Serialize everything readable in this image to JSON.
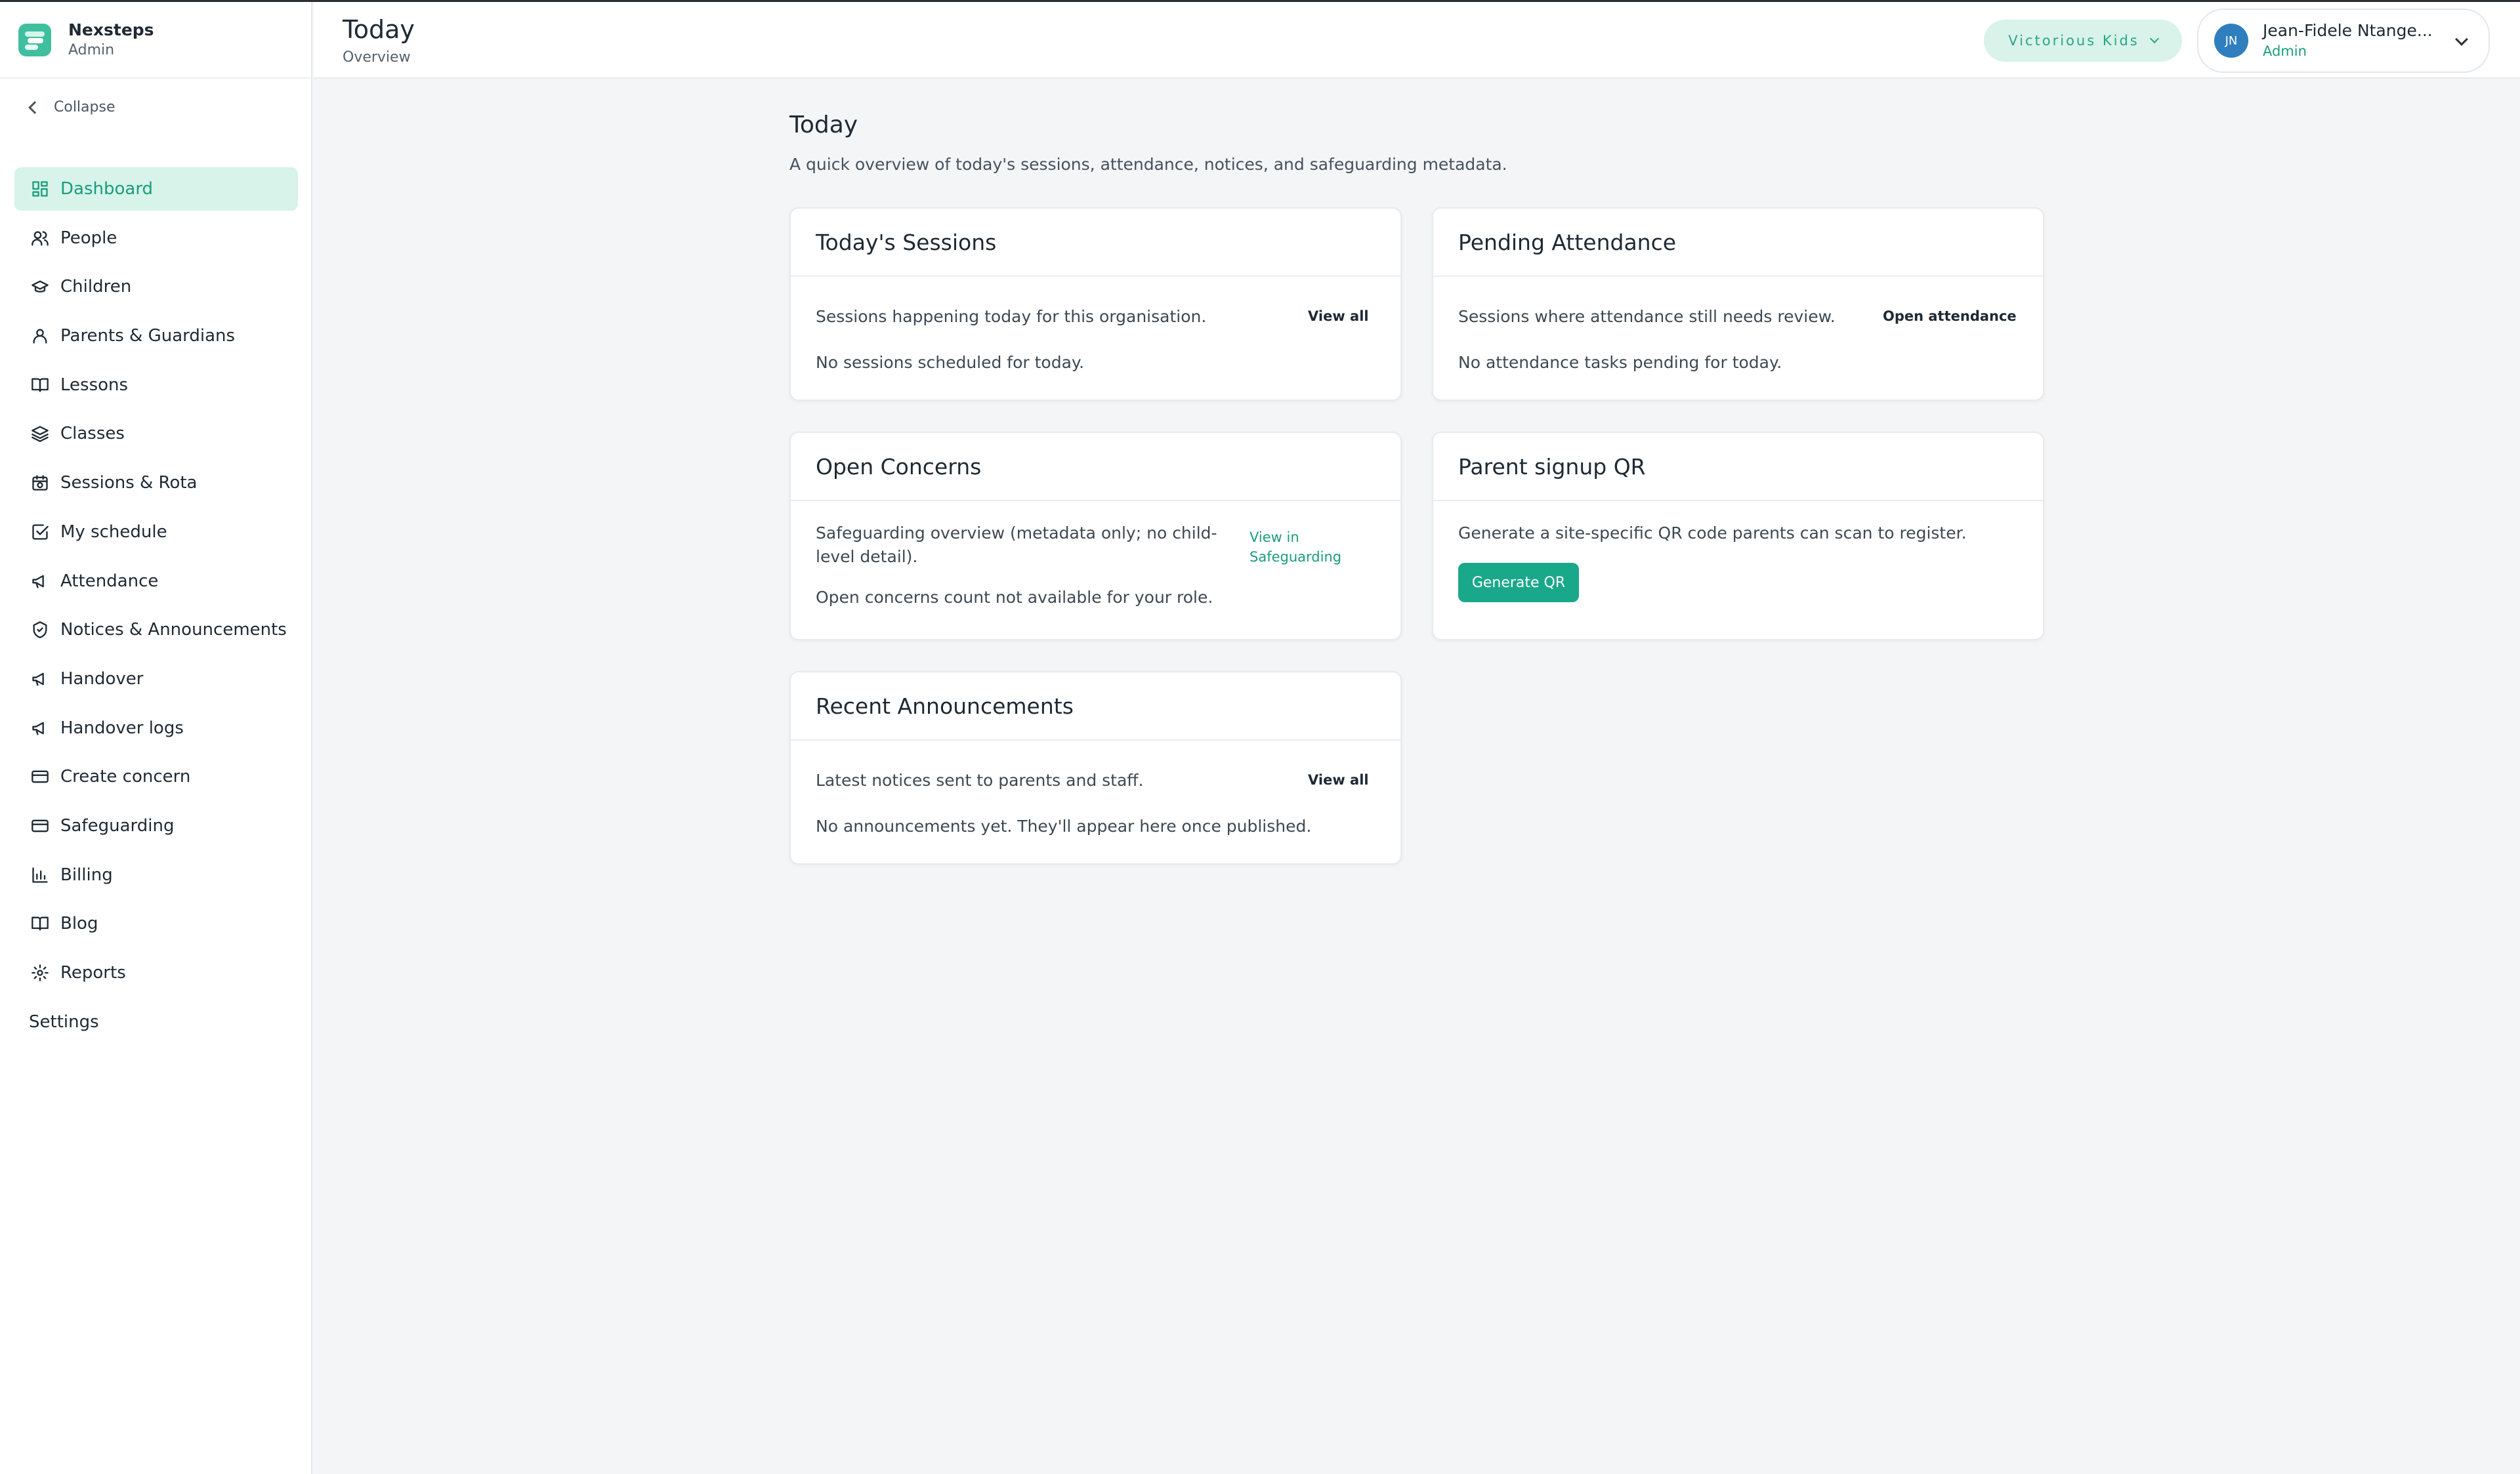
{
  "brand": {
    "name": "Nexsteps",
    "role": "Admin"
  },
  "sidebar": {
    "collapse_label": "Collapse",
    "items": [
      {
        "label": "Dashboard",
        "icon": "grid-icon"
      },
      {
        "label": "People",
        "icon": "users-icon"
      },
      {
        "label": "Children",
        "icon": "graduation-cap-icon"
      },
      {
        "label": "Parents & Guardians",
        "icon": "user-icon"
      },
      {
        "label": "Lessons",
        "icon": "book-icon"
      },
      {
        "label": "Classes",
        "icon": "layers-icon"
      },
      {
        "label": "Sessions & Rota",
        "icon": "calendar-clock-icon"
      },
      {
        "label": "My schedule",
        "icon": "check-square-icon"
      },
      {
        "label": "Attendance",
        "icon": "megaphone-icon"
      },
      {
        "label": "Notices & Announcements",
        "icon": "shield-icon"
      },
      {
        "label": "Handover",
        "icon": "megaphone-icon"
      },
      {
        "label": "Handover logs",
        "icon": "megaphone-icon"
      },
      {
        "label": "Create concern",
        "icon": "card-icon"
      },
      {
        "label": "Safeguarding",
        "icon": "card-icon"
      },
      {
        "label": "Billing",
        "icon": "bar-chart-icon"
      },
      {
        "label": "Blog",
        "icon": "book-icon"
      },
      {
        "label": "Reports",
        "icon": "gear-icon"
      },
      {
        "label": "Settings",
        "icon": ""
      }
    ]
  },
  "header": {
    "title": "Today",
    "subtitle": "Overview",
    "org": "Victorious Kids",
    "user": {
      "initials": "JN",
      "name": "Jean-Fidele Ntange...",
      "role": "Admin"
    }
  },
  "main": {
    "title": "Today",
    "description": "A quick overview of today's sessions, attendance, notices, and safeguarding metadata."
  },
  "cards": {
    "sessions": {
      "title": "Today's Sessions",
      "description": "Sessions happening today for this organisation.",
      "link": "View all",
      "empty": "No sessions scheduled for today."
    },
    "attendance": {
      "title": "Pending Attendance",
      "description": "Sessions where attendance still needs review.",
      "link": "Open attendance",
      "empty": "No attendance tasks pending for today."
    },
    "concerns": {
      "title": "Open Concerns",
      "description_line1": "Safeguarding overview (metadata only; no child-",
      "description_line2": "level detail).",
      "link_line1": "View in",
      "link_line2": "Safeguarding",
      "empty": "Open concerns count not available for your role."
    },
    "qr": {
      "title": "Parent signup QR",
      "description": "Generate a site-specific QR code parents can scan to register.",
      "button": "Generate QR"
    },
    "announcements": {
      "title": "Recent Announcements",
      "description": "Latest notices sent to parents and staff.",
      "link": "View all",
      "empty": "No announcements yet. They'll appear here once published."
    }
  },
  "colors": {
    "accent": "#1aa88a",
    "active_bg": "#d7f3ea",
    "background": "#f4f5f7"
  }
}
